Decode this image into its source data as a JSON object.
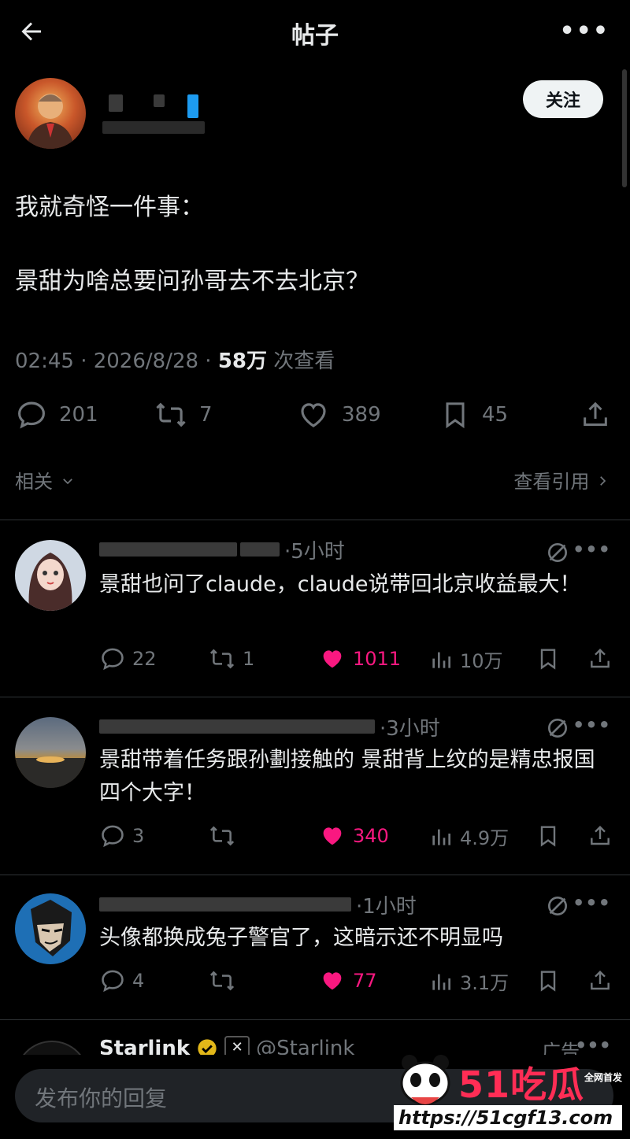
{
  "header": {
    "title": "帖子",
    "back_icon": "arrow-left-icon",
    "more_label": "•••"
  },
  "post": {
    "follow_label": "关注",
    "lines": [
      "我就奇怪一件事：",
      "景甜为啥总要问孙哥去不去北京？"
    ],
    "time": "02:45 · 2026/8/28 · ",
    "views_bold": "58万",
    "views_suffix": " 次查看",
    "counts": {
      "replies": "201",
      "reposts": "7",
      "likes": "389",
      "bookmarks": "45"
    }
  },
  "section": {
    "related": "相关",
    "quotes": "查看引用"
  },
  "replies": [
    {
      "time": "·5小时",
      "text": "景甜也问了claude，claude说带回北京收益最大！",
      "replies": "22",
      "reposts": "1",
      "likes": "1011",
      "views": "10万"
    },
    {
      "time": "·3小时",
      "text": "景甜带着任务跟孙劃接触的 景甜背上纹的是精忠报国四个大字！",
      "replies": "3",
      "reposts": "",
      "likes": "340",
      "views": "4.9万"
    },
    {
      "time": "·1小时",
      "text": "头像都换成兔子警官了，这暗示还不明显吗",
      "replies": "4",
      "reposts": "",
      "likes": "77",
      "views": "3.1万"
    }
  ],
  "ad": {
    "name": "Starlink",
    "handle": "@Starlink",
    "label": "广告"
  },
  "compose": {
    "placeholder": "发布你的回复"
  },
  "watermark": {
    "brand": "51吃瓜",
    "tag": "全网首发",
    "url": "https://51cgf13.com"
  },
  "colors": {
    "accent_like": "#f91880",
    "muted": "#71767b",
    "text": "#e7e9ea"
  }
}
